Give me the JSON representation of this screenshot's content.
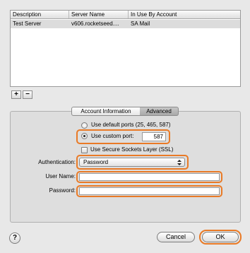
{
  "table": {
    "columns": [
      "Description",
      "Server Name",
      "In Use By Account"
    ],
    "rows": [
      {
        "description": "Test Server",
        "server_name": "v606.rocketseed....",
        "in_use_by": "SA Mail"
      }
    ]
  },
  "list_buttons": {
    "add": "+",
    "remove": "−"
  },
  "tabs": {
    "account": "Account Information",
    "advanced": "Advanced"
  },
  "ports": {
    "default_label": "Use default ports (25, 465, 587)",
    "custom_label": "Use custom port:",
    "custom_value": "587"
  },
  "ssl_label": "Use Secure Sockets Layer (SSL)",
  "authentication": {
    "label": "Authentication:",
    "selected": "Password"
  },
  "user_name": {
    "label": "User Name:",
    "value": ""
  },
  "password": {
    "label": "Password:",
    "value": ""
  },
  "buttons": {
    "help": "?",
    "cancel": "Cancel",
    "ok": "OK"
  },
  "colors": {
    "highlight": "#e97a26",
    "selected_row": "#dcdcdc"
  }
}
